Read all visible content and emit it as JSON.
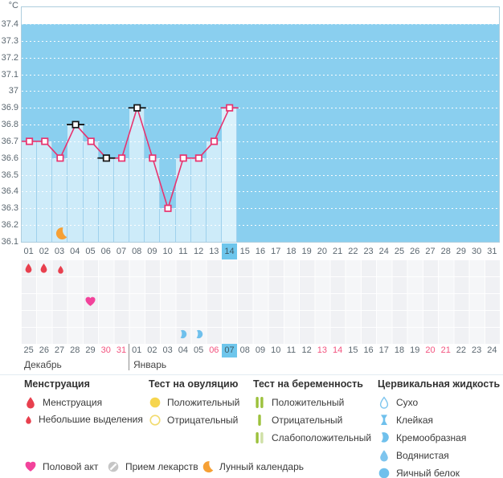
{
  "unit_label": "°C",
  "colors": {
    "plot_bg": "#8ACFEF",
    "bar_fill": "#CDEBF9",
    "bar_selected": "#D9F1FB",
    "line_pink": "#E8326E",
    "marker_black": "#141414",
    "highlight_blue": "#6EC6EC",
    "weekend_red": "#F3537F",
    "text_gray": "#5B6770",
    "drop_red": "#E8404E",
    "heart_pink": "#F2439B",
    "moon_orange": "#F6A035",
    "cervical_blue": "#6FC0EC",
    "ovulation_yellow": "#F6D54E",
    "pregnancy_green": "#9CC13C",
    "pregnancy_green_light": "#CFE0A6"
  },
  "chart_data": {
    "type": "line",
    "title": "",
    "ylabel": "°C",
    "ylim": [
      36.1,
      37.4
    ],
    "grid_step": 0.1,
    "grid": true,
    "y_tick_labels": [
      "37.4",
      "37.3",
      "37.2",
      "37.1",
      "37",
      "36.9",
      "36.8",
      "36.7",
      "36.6",
      "36.5",
      "36.4",
      "36.3",
      "36.2",
      "36.1"
    ],
    "x_categories": [
      "01",
      "02",
      "03",
      "04",
      "05",
      "06",
      "07",
      "08",
      "09",
      "10",
      "11",
      "12",
      "13",
      "14",
      "15",
      "16",
      "17",
      "18",
      "19",
      "20",
      "21",
      "22",
      "23",
      "24",
      "25",
      "26",
      "27",
      "28",
      "29",
      "30",
      "31"
    ],
    "selected_column": 14,
    "series": [
      {
        "name": "temperature",
        "points": [
          {
            "day": 1,
            "t": 36.7
          },
          {
            "day": 2,
            "t": 36.7
          },
          {
            "day": 3,
            "t": 36.6
          },
          {
            "day": 4,
            "t": 36.8
          },
          {
            "day": 5,
            "t": 36.7
          },
          {
            "day": 6,
            "t": 36.6
          },
          {
            "day": 7,
            "t": 36.6
          },
          {
            "day": 8,
            "t": 36.9
          },
          {
            "day": 9,
            "t": 36.6
          },
          {
            "day": 10,
            "t": 36.3
          },
          {
            "day": 11,
            "t": 36.6
          },
          {
            "day": 12,
            "t": 36.6
          },
          {
            "day": 13,
            "t": 36.7
          },
          {
            "day": 14,
            "t": 36.9
          }
        ]
      }
    ],
    "black_marker_days": [
      4,
      6,
      8
    ],
    "hline_marker_days": [
      4,
      6,
      8,
      14
    ],
    "moon_day": 3
  },
  "events": {
    "menstruation": [
      {
        "day": 1,
        "kind": "full"
      },
      {
        "day": 2,
        "kind": "full"
      },
      {
        "day": 3,
        "kind": "spotting"
      }
    ],
    "intercourse_days": [
      5
    ],
    "cervical_creamy_days": [
      11,
      12
    ]
  },
  "calendar": {
    "dates": [
      "25",
      "26",
      "27",
      "28",
      "29",
      "30",
      "31",
      "01",
      "02",
      "03",
      "04",
      "05",
      "06",
      "07",
      "08",
      "09",
      "10",
      "11",
      "12",
      "13",
      "14",
      "15",
      "16",
      "17",
      "18",
      "19",
      "20",
      "21",
      "22",
      "23",
      "24"
    ],
    "weekend_indices": [
      6,
      7,
      13,
      20,
      21,
      27,
      28
    ],
    "today_index": 14,
    "months": [
      {
        "name": "Декабрь"
      },
      {
        "name": "Январь"
      }
    ]
  },
  "legend": {
    "sections": [
      {
        "title": "Менструация",
        "items": [
          {
            "icon": "drop-large",
            "label": "Менструация"
          },
          {
            "icon": "drop-small",
            "label": "Небольшие выделения"
          }
        ]
      },
      {
        "title": "Тест на овуляцию",
        "items": [
          {
            "icon": "circle-filled-yellow",
            "label": "Положительный"
          },
          {
            "icon": "circle-outline-yellow",
            "label": "Отрицательный"
          }
        ]
      },
      {
        "title": "Тест на беременность",
        "items": [
          {
            "icon": "bars-two-green",
            "label": "Положительный"
          },
          {
            "icon": "bar-one-green",
            "label": "Отрицательный"
          },
          {
            "icon": "bars-weak-green",
            "label": "Слабоположительный"
          }
        ]
      },
      {
        "title": "Цервикальная жидкость",
        "items": [
          {
            "icon": "drop-outline-blue",
            "label": "Сухо"
          },
          {
            "icon": "hourglass-blue",
            "label": "Клейкая"
          },
          {
            "icon": "comma-blue",
            "label": "Кремообразная"
          },
          {
            "icon": "drop-blue",
            "label": "Водянистая"
          },
          {
            "icon": "circle-blue",
            "label": "Яичный белок"
          }
        ]
      }
    ],
    "misc": [
      {
        "icon": "heart-pink",
        "label": "Половой акт"
      },
      {
        "icon": "pill-gray",
        "label": "Прием лекарств"
      },
      {
        "icon": "moon-orange",
        "label": "Лунный календарь"
      }
    ]
  }
}
